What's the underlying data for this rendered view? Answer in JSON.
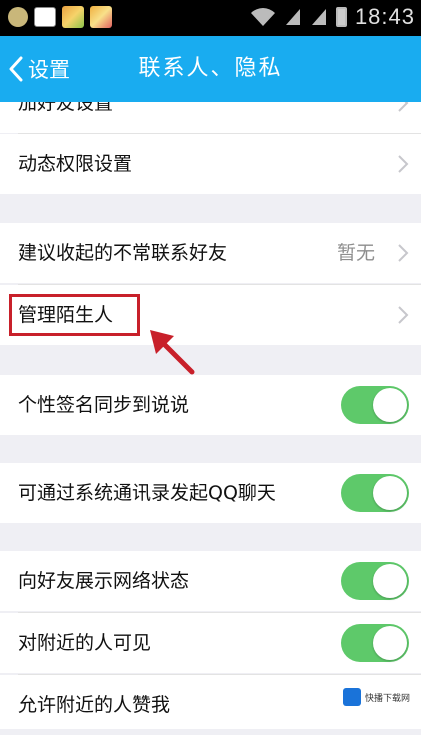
{
  "statusbar": {
    "time": "18:43"
  },
  "header": {
    "back_label": "设置",
    "title": "联系人、隐私"
  },
  "rows": {
    "partial": {
      "label": "加好友设置"
    },
    "dynamic": {
      "label": "动态权限设置"
    },
    "suggest": {
      "label": "建议收起的不常联系好友",
      "value": "暂无"
    },
    "stranger": {
      "label": "管理陌生人"
    },
    "signature": {
      "label": "个性签名同步到说说",
      "on": true
    },
    "contacts": {
      "label": "可通过系统通讯录发起QQ聊天",
      "on": true
    },
    "network": {
      "label": "向好友展示网络状态",
      "on": true
    },
    "nearby": {
      "label": "对附近的人可见",
      "on": true
    },
    "like": {
      "label": "允许附近的人赞我"
    }
  },
  "watermark": {
    "text": "快播下载网"
  },
  "colors": {
    "titlebar": "#19acf0",
    "toggle_on": "#5ec96a",
    "highlight": "#c8202a"
  }
}
